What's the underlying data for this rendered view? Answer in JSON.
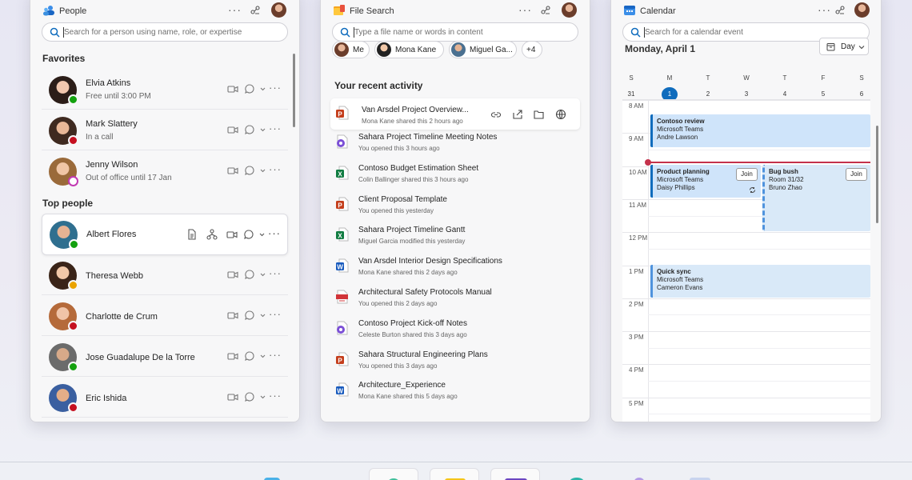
{
  "people": {
    "title": "People",
    "search_placeholder": "Search for a person using name, role, or expertise",
    "favorites_label": "Favorites",
    "top_people_label": "Top people",
    "favorites": [
      {
        "name": "Elvia Atkins",
        "status_text": "Free until 3:00 PM",
        "presence": "available",
        "presence_color": "#13a10e"
      },
      {
        "name": "Mark Slattery",
        "status_text": "In a call",
        "presence": "busy",
        "presence_color": "#c50f1f"
      },
      {
        "name": "Jenny Wilson",
        "status_text": "Out of office until 17 Jan",
        "presence": "out-of-office",
        "presence_color": "#c239b3"
      }
    ],
    "top_people": [
      {
        "name": "Albert Flores",
        "presence": "available",
        "presence_color": "#13a10e"
      },
      {
        "name": "Theresa Webb",
        "presence": "away",
        "presence_color": "#eaa300"
      },
      {
        "name": "Charlotte de Crum",
        "presence": "do-not-disturb",
        "presence_color": "#c50f1f"
      },
      {
        "name": "Jose Guadalupe De la Torre",
        "presence": "available",
        "presence_color": "#13a10e"
      },
      {
        "name": "Eric Ishida",
        "presence": "busy",
        "presence_color": "#c50f1f"
      }
    ]
  },
  "files": {
    "title": "File Search",
    "search_placeholder": "Type a file name or words in content",
    "chips": [
      {
        "label": "Me"
      },
      {
        "label": "Mona Kane"
      },
      {
        "label": "Miguel Ga..."
      }
    ],
    "chips_more": "+4",
    "recent_label": "Your recent activity",
    "items": [
      {
        "name": "Van Arsdel Project Overview...",
        "sub": "Mona Kane shared this 2 hours ago",
        "type": "powerpoint"
      },
      {
        "name": "Sahara Project Timeline Meeting Notes",
        "sub": "You opened this 3 hours ago",
        "type": "loop"
      },
      {
        "name": "Contoso Budget Estimation Sheet",
        "sub": "Colin Ballinger shared this 3 hours ago",
        "type": "excel"
      },
      {
        "name": "Client Proposal Template",
        "sub": "You opened this yesterday",
        "type": "powerpoint"
      },
      {
        "name": "Sahara Project Timeline Gantt",
        "sub": "Miguel Garcia modified this yesterday",
        "type": "excel"
      },
      {
        "name": "Van Arsdel Interior Design Specifications",
        "sub": "Mona Kane shared this 2 days ago",
        "type": "word"
      },
      {
        "name": "Architectural Safety Protocols Manual",
        "sub": "You opened this 2 days ago",
        "type": "pdf"
      },
      {
        "name": "Contoso Project Kick-off  Notes",
        "sub": "Celeste Burton shared this 3 days ago",
        "type": "loop"
      },
      {
        "name": "Sahara Structural Engineering Plans",
        "sub": "You opened this 3 days ago",
        "type": "powerpoint"
      },
      {
        "name": "Architecture_Experience",
        "sub": "Mona Kane shared this 5 days ago",
        "type": "word"
      }
    ]
  },
  "calendar": {
    "title": "Calendar",
    "search_placeholder": "Search for a calendar event",
    "date_heading": "Monday, April 1",
    "view_label": "Day",
    "weekdays": [
      "S",
      "M",
      "T",
      "W",
      "T",
      "F",
      "S"
    ],
    "days": [
      "31",
      "1",
      "2",
      "3",
      "4",
      "5",
      "6"
    ],
    "today_index": 1,
    "hours": [
      "8 AM",
      "9 AM",
      "10 AM",
      "11 AM",
      "12 PM",
      "1 PM",
      "2 PM",
      "3 PM",
      "4 PM",
      "5 PM"
    ],
    "events": [
      {
        "title": "Contoso review",
        "line1": "Microsoft Teams",
        "line2": "Andre Lawson"
      },
      {
        "title": "Product planning",
        "line1": "Microsoft Teams",
        "line2": "Daisy Phillips",
        "join": "Join"
      },
      {
        "title": "Bug bush",
        "line1": "Room 31/32",
        "line2": "Bruno Zhao",
        "join": "Join"
      },
      {
        "title": "Quick sync",
        "line1": "Microsoft Teams",
        "line2": "Cameron Evans"
      }
    ]
  },
  "colors": {
    "accent": "#0f6cbd",
    "event_fill": "#cfe4fa",
    "now_line": "#c4314b",
    "word": "#185abd",
    "excel": "#107c41",
    "powerpoint": "#c43e1c",
    "loop": "#7b4fd6",
    "pdf": "#d13438"
  }
}
